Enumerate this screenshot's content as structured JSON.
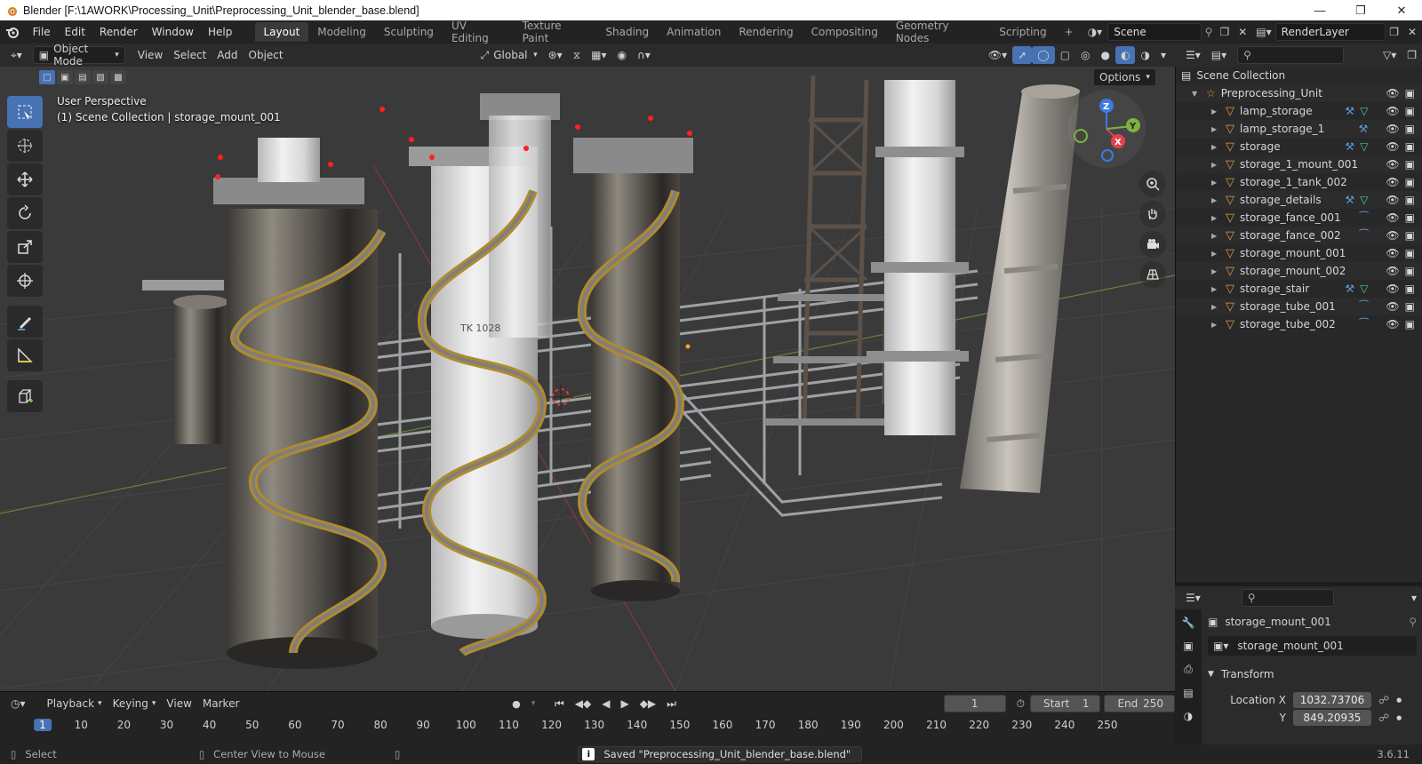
{
  "window": {
    "title": "Blender [F:\\1AWORK\\Processing_Unit\\Preprocessing_Unit_blender_base.blend]",
    "controls": [
      "minimize-icon",
      "maximize-icon",
      "close-icon"
    ]
  },
  "menu": [
    "File",
    "Edit",
    "Render",
    "Window",
    "Help"
  ],
  "workspaces": [
    "Layout",
    "Modeling",
    "Sculpting",
    "UV Editing",
    "Texture Paint",
    "Shading",
    "Animation",
    "Rendering",
    "Compositing",
    "Geometry Nodes",
    "Scripting"
  ],
  "active_workspace": "Layout",
  "scene": {
    "label": "Scene",
    "render_layer": "RenderLayer"
  },
  "viewport_header": {
    "mode": "Object Mode",
    "menus": [
      "View",
      "Select",
      "Add",
      "Object"
    ],
    "orientation": "Global",
    "options_label": "Options"
  },
  "viewport": {
    "perspective": "User Perspective",
    "collection_info": "(1) Scene Collection | storage_mount_001",
    "tank_label": "TK 1028",
    "gizmo_axes": {
      "z": "Z",
      "y": "Y",
      "x": "X"
    },
    "colors": {
      "x_axis": "#e04050",
      "y_axis": "#7cb340",
      "z_axis": "#3d7be0",
      "grid": "#474747",
      "background": "#3a3a3a"
    }
  },
  "toolbar": [
    "select-box-icon",
    "cursor-icon",
    "move-icon",
    "rotate-icon",
    "scale-icon",
    "transform-icon",
    "annotate-icon",
    "measure-icon",
    "add-cube-icon"
  ],
  "nav_buttons": [
    "zoom-icon",
    "pan-hand-icon",
    "camera-icon",
    "grid-view-icon"
  ],
  "outliner": {
    "root": "Scene Collection",
    "collection": "Preprocessing_Unit",
    "items": [
      {
        "name": "lamp_storage",
        "extra": "wrench+mesh"
      },
      {
        "name": "lamp_storage_1",
        "extra": "wrench"
      },
      {
        "name": "storage",
        "extra": "wrench+mesh"
      },
      {
        "name": "storage_1_mount_001",
        "extra": ""
      },
      {
        "name": "storage_1_tank_002",
        "extra": ""
      },
      {
        "name": "storage_details",
        "extra": "wrench+mesh"
      },
      {
        "name": "storage_fance_001",
        "extra": "curve"
      },
      {
        "name": "storage_fance_002",
        "extra": "curve"
      },
      {
        "name": "storage_mount_001",
        "extra": ""
      },
      {
        "name": "storage_mount_002",
        "extra": ""
      },
      {
        "name": "storage_stair",
        "extra": "wrench+mesh"
      },
      {
        "name": "storage_tube_001",
        "extra": "curve"
      },
      {
        "name": "storage_tube_002",
        "extra": "curve"
      }
    ]
  },
  "properties": {
    "object_name": "storage_mount_001",
    "data_name": "storage_mount_001",
    "panel": "Transform",
    "location_label": "Location X",
    "location_x": "1032.73706",
    "y_label": "Y",
    "location_y": "849.20935"
  },
  "timeline": {
    "menus": [
      "Playback",
      "Keying",
      "View",
      "Marker"
    ],
    "current_frame": "1",
    "start_label": "Start",
    "start": "1",
    "end_label": "End",
    "end": "250",
    "ruler": [
      "1",
      "10",
      "20",
      "30",
      "40",
      "50",
      "60",
      "70",
      "80",
      "90",
      "100",
      "110",
      "120",
      "130",
      "140",
      "150",
      "160",
      "170",
      "180",
      "190",
      "200",
      "210",
      "220",
      "230",
      "240",
      "250"
    ]
  },
  "status": {
    "select": "Select",
    "center_view": "Center View to Mouse",
    "message": "Saved \"Preprocessing_Unit_blender_base.blend\"",
    "version": "3.6.11"
  }
}
